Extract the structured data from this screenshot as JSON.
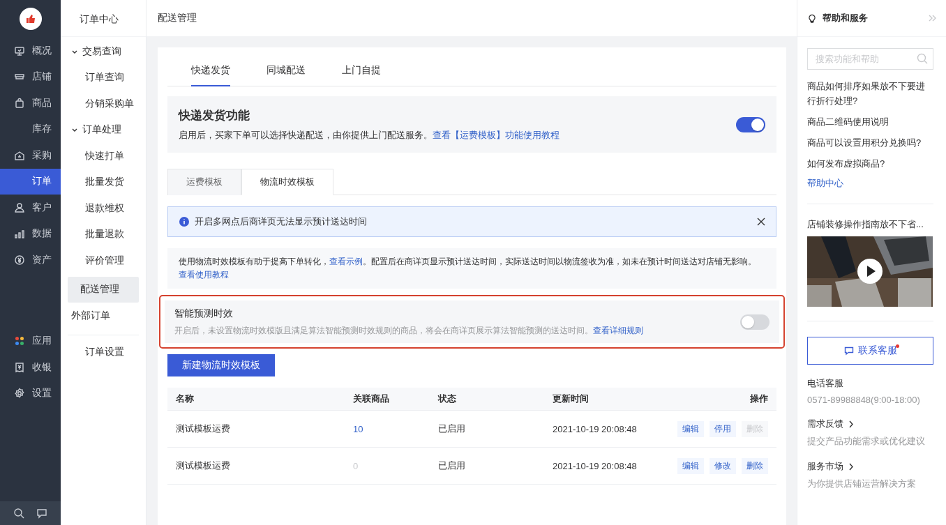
{
  "rail": {
    "items": [
      {
        "label": "概况",
        "kind": "monitor",
        "selected": false
      },
      {
        "label": "店铺",
        "kind": "shop",
        "selected": false
      },
      {
        "label": "商品",
        "kind": "bag",
        "selected": false
      },
      {
        "label": "库存",
        "kind": "none",
        "selected": false
      },
      {
        "label": "采购",
        "kind": "house",
        "selected": false
      },
      {
        "label": "订单",
        "kind": "none",
        "selected": true
      },
      {
        "label": "客户",
        "kind": "person",
        "selected": false
      },
      {
        "label": "数据",
        "kind": "bars",
        "selected": false
      },
      {
        "label": "资产",
        "kind": "coin",
        "selected": false
      }
    ],
    "bottom_items": [
      {
        "label": "应用",
        "kind": "apps",
        "selected": false
      },
      {
        "label": "收银",
        "kind": "receipt",
        "selected": false
      },
      {
        "label": "设置",
        "kind": "gear",
        "selected": false
      }
    ]
  },
  "subnav": {
    "title": "订单中心",
    "items": [
      {
        "label": "交易查询",
        "selected": false,
        "expanded": true,
        "children": [
          {
            "label": "订单查询",
            "selected": false
          },
          {
            "label": "分销采购单",
            "selected": false
          }
        ]
      },
      {
        "label": "订单处理",
        "selected": false,
        "expanded": true,
        "children": [
          {
            "label": "快速打单",
            "selected": false
          },
          {
            "label": "批量发货",
            "selected": false
          },
          {
            "label": "退款维权",
            "selected": false
          },
          {
            "label": "批量退款",
            "selected": false
          },
          {
            "label": "评价管理",
            "selected": false
          }
        ]
      },
      {
        "label": "配送管理",
        "selected": true
      },
      {
        "label": "外部订单",
        "selected": false
      }
    ],
    "footer_items": [
      {
        "label": "订单设置",
        "selected": false
      }
    ]
  },
  "page": {
    "title": "配送管理",
    "tabs": [
      {
        "label": "快递发货",
        "selected": true
      },
      {
        "label": "同城配送",
        "selected": false
      },
      {
        "label": "上门自提",
        "selected": false
      }
    ],
    "feature": {
      "title": "快递发货功能",
      "description": "启用后，买家下单可以选择快递配送，由你提供上门配送服务。",
      "link": "查看【运费模板】功能使用教程",
      "on": true
    },
    "subtabs": [
      {
        "label": "运费模板",
        "selected": false
      },
      {
        "label": "物流时效模板",
        "selected": true
      }
    ],
    "notice": {
      "text": "开启多网点后商详页无法显示预计送达时间"
    },
    "info": [
      {
        "kind": "text",
        "text": "使用物流时效模板有助于提高下单转化，"
      },
      {
        "kind": "link",
        "text": "查看示例"
      },
      {
        "kind": "text",
        "text": "。配置后在商详页显示预计送达时间，实际送达时间以物流签收为准，如未在预计时间送达对店铺无影响。"
      },
      {
        "kind": "link",
        "text": "查看使用教程"
      }
    ],
    "smart": {
      "title": "智能预测时效",
      "description": "开启后，未设置物流时效模版且满足算法智能预测时效规则的商品，将会在商详页展示算法智能预测的送达时间。",
      "link": "查看详细规则",
      "on": false,
      "highlighted": true
    },
    "create_button": "新建物流时效模板",
    "table": {
      "columns": [
        "名称",
        "关联商品",
        "状态",
        "更新时间",
        "操作"
      ],
      "rows": [
        {
          "name": "测试模板运费",
          "count": "10",
          "linked": true,
          "status": "已启用",
          "updated": "2021-10-19 20:08:48",
          "actions": [
            {
              "label": "编辑",
              "disabled": false
            },
            {
              "label": "停用",
              "disabled": false
            },
            {
              "label": "删除",
              "disabled": true
            }
          ]
        },
        {
          "name": "测试模板运费",
          "count": "0",
          "linked": false,
          "status": "已启用",
          "updated": "2021-10-19 20:08:48",
          "actions": [
            {
              "label": "编辑",
              "disabled": false
            },
            {
              "label": "修改",
              "disabled": false
            },
            {
              "label": "删除",
              "disabled": false
            }
          ]
        }
      ]
    }
  },
  "help": {
    "title": "帮助和服务",
    "search": {
      "placeholder": "搜索功能和帮助"
    },
    "questions": [
      "商品如何排序如果放不下要进行折行处理?",
      "商品二维码使用说明",
      "商品可以设置用积分兑换吗?",
      "如何发布虚拟商品?"
    ],
    "help_center": "帮助中心",
    "video": {
      "title": "店铺装修操作指南放不下省...",
      "kind": "picture"
    },
    "contact": {
      "label": "联系客服",
      "badge": true
    },
    "phone": {
      "label": "电话客服",
      "number": "0571-89988848(9:00-18:00)"
    },
    "links": [
      {
        "title": "需求反馈",
        "description": "提交产品功能需求或优化建议"
      },
      {
        "title": "服务市场",
        "description": "为你提供店铺运营解决方案"
      }
    ]
  }
}
